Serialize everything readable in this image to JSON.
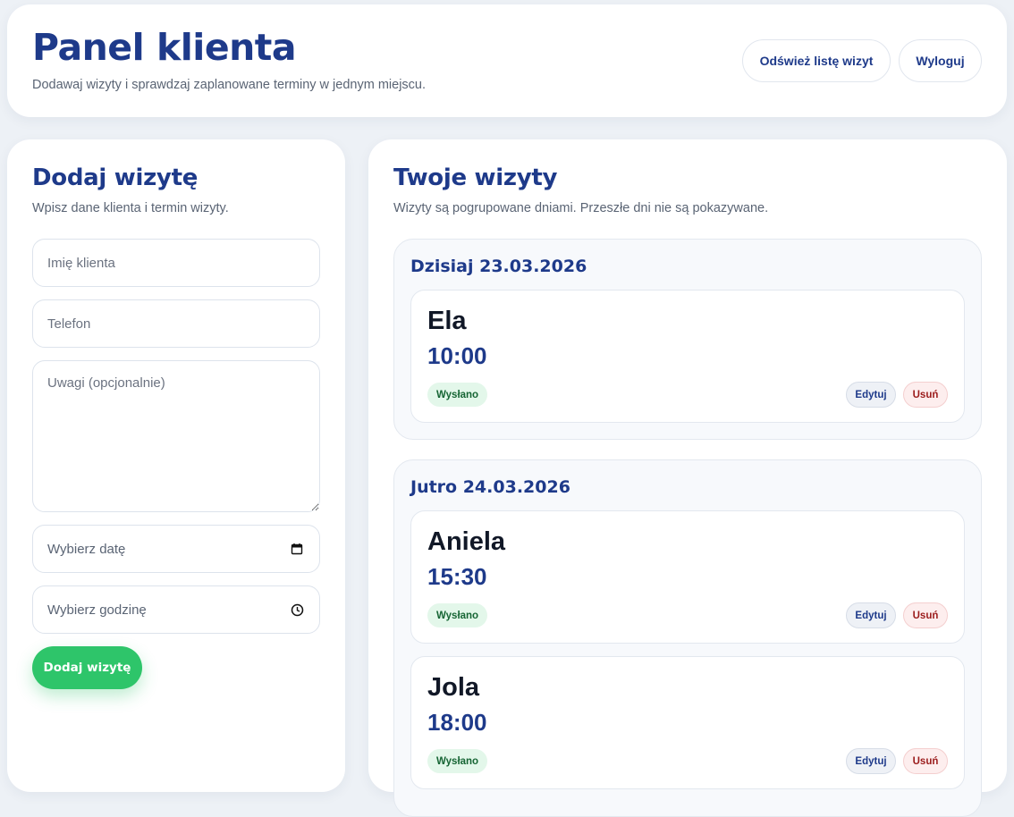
{
  "header": {
    "title": "Panel klienta",
    "subtitle": "Dodawaj wizyty i sprawdzaj zaplanowane terminy w jednym miejscu.",
    "refresh_label": "Odśwież listę wizyt",
    "logout_label": "Wyloguj"
  },
  "form": {
    "title": "Dodaj wizytę",
    "subtitle": "Wpisz dane klienta i termin wizyty.",
    "name_placeholder": "Imię klienta",
    "phone_placeholder": "Telefon",
    "notes_placeholder": "Uwagi (opcjonalnie)",
    "date_placeholder": "Wybierz datę",
    "time_placeholder": "Wybierz godzinę",
    "submit_label": "Dodaj wizytę",
    "date_icon": "calendar-icon",
    "time_icon": "clock-icon"
  },
  "visits": {
    "title": "Twoje wizyty",
    "subtitle": "Wizyty są pogrupowane dniami. Przeszłe dni nie są pokazywane.",
    "groups": [
      {
        "label": "Dzisiaj 23.03.2026",
        "items": [
          {
            "name": "Ela",
            "time": "10:00",
            "status": "Wysłano",
            "edit": "Edytuj",
            "delete": "Usuń"
          }
        ]
      },
      {
        "label": "Jutro 24.03.2026",
        "items": [
          {
            "name": "Aniela",
            "time": "15:30",
            "status": "Wysłano",
            "edit": "Edytuj",
            "delete": "Usuń"
          },
          {
            "name": "Jola",
            "time": "18:00",
            "status": "Wysłano",
            "edit": "Edytuj",
            "delete": "Usuń"
          }
        ]
      }
    ]
  },
  "colors": {
    "brand": "#1e3a8a",
    "accent_green": "#2ec56a",
    "status_bg": "#e3f7ea",
    "delete_text": "#9b1c1c",
    "page_bg": "#edf1f6"
  }
}
